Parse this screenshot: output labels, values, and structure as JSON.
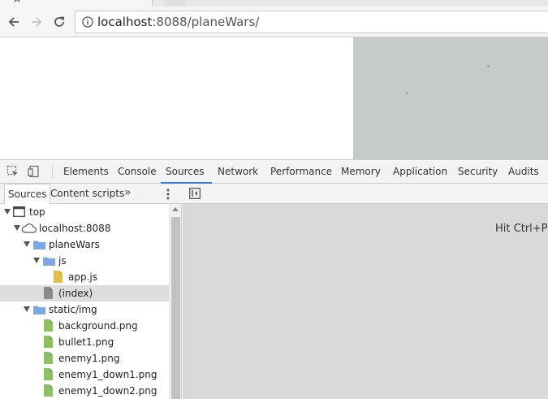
{
  "browser": {
    "url_host": "localhost",
    "url_rest": ":8088/planeWars/"
  },
  "devtools": {
    "tabs": [
      "Elements",
      "Console",
      "Sources",
      "Network",
      "Performance",
      "Memory",
      "Application",
      "Security",
      "Audits"
    ],
    "active_tab": "Sources",
    "navigator": {
      "tabs": [
        "Sources",
        "Content scripts"
      ],
      "more": "»",
      "tree": [
        {
          "label": "top"
        },
        {
          "label": "localhost:8088"
        },
        {
          "label": "planeWars"
        },
        {
          "label": "js"
        },
        {
          "label": "app.js"
        },
        {
          "label": "(index)"
        },
        {
          "label": "static/img"
        },
        {
          "label": "background.png"
        },
        {
          "label": "bullet1.png"
        },
        {
          "label": "enemy1.png"
        },
        {
          "label": "enemy1_down1.png"
        },
        {
          "label": "enemy1_down2.png"
        }
      ]
    },
    "editor": {
      "hint": "Hit Ctrl+P"
    }
  },
  "colors": {
    "accent": "#3879d9",
    "folder": "#7aa9e6",
    "script_file": "#e0c04a",
    "image_file": "#8cc063",
    "document_file": "#8a8a8a",
    "canvas": "#c5cbca"
  }
}
